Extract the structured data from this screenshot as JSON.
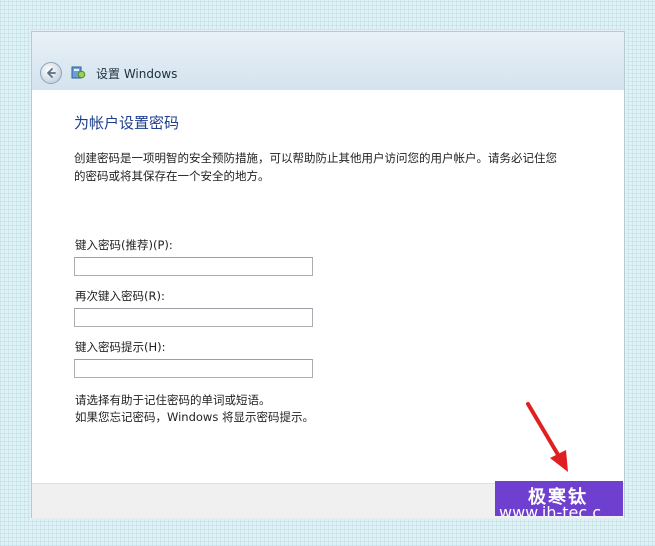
{
  "window": {
    "title": "设置 Windows"
  },
  "page": {
    "heading": "为帐户设置密码",
    "description_line1": "创建密码是一项明智的安全预防措施，可以帮助防止其他用户访问您的用户帐户。请务必记住您",
    "description_line2": "的密码或将其保存在一个安全的地方。"
  },
  "form": {
    "password_label": "键入密码(推荐)(P):",
    "password_value": "",
    "confirm_label": "再次键入密码(R):",
    "confirm_value": "",
    "hint_label": "键入密码提示(H):",
    "hint_value": ""
  },
  "hint_text": {
    "line1": "请选择有助于记住密码的单词或短语。",
    "line2": "如果您忘记密码，Windows 将显示密码提示。"
  },
  "watermark": {
    "name": "极寒钛",
    "url": "www.jh-tec.c"
  },
  "colors": {
    "heading": "#1e3e8c",
    "annotation_arrow": "#e02020",
    "watermark_bg": "#6f3fcf"
  },
  "icons": [
    "back-arrow-icon",
    "setup-icon"
  ]
}
